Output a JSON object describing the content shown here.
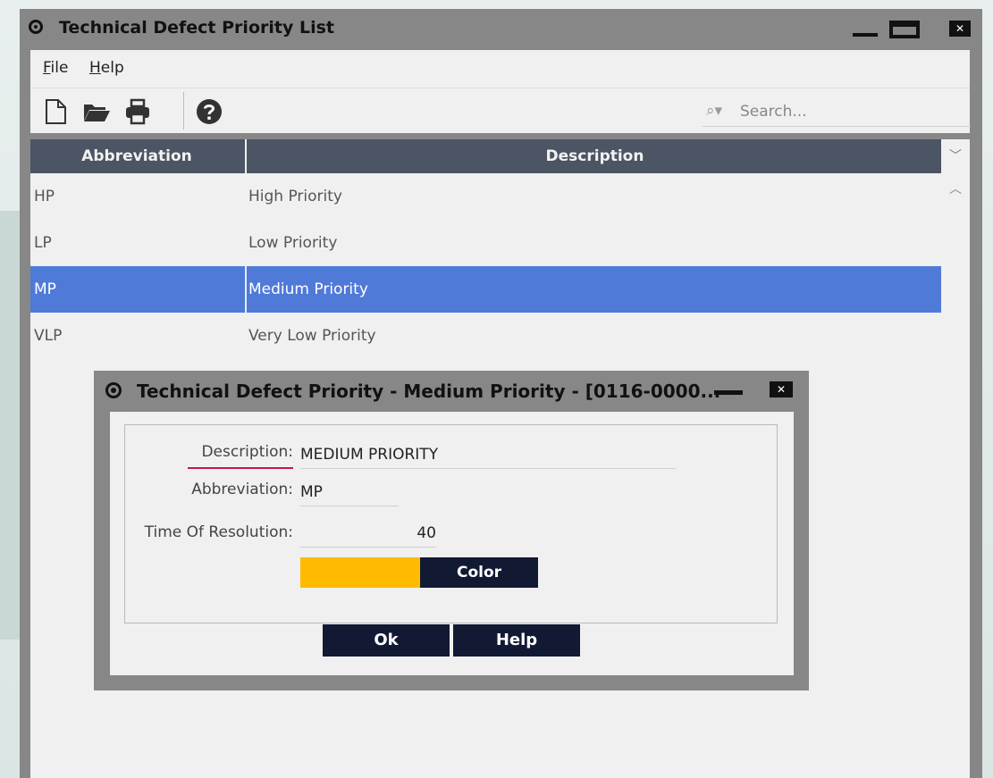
{
  "window": {
    "title": "Technical Defect Priority List",
    "controls": {
      "minimize": "minimize",
      "maximize": "maximize",
      "close": "✕"
    }
  },
  "menu": {
    "items": [
      {
        "label_first": "F",
        "label_rest": "ile"
      },
      {
        "label_first": "H",
        "label_rest": "elp"
      }
    ]
  },
  "toolbar": {
    "icons": [
      "new-document-icon",
      "open-folder-icon",
      "print-icon",
      "help-icon"
    ],
    "search_placeholder": "Search..."
  },
  "table": {
    "columns": [
      "Abbreviation",
      "Description"
    ],
    "rows": [
      {
        "abbr": "HP",
        "desc": "High Priority"
      },
      {
        "abbr": "LP",
        "desc": "Low Priority"
      },
      {
        "abbr": "MP",
        "desc": "Medium Priority",
        "selected": true
      },
      {
        "abbr": "VLP",
        "desc": "Very Low Priority"
      }
    ]
  },
  "dialog": {
    "title": "Technical Defect Priority - Medium Priority - [0116-0000...",
    "close": "✕",
    "fields": {
      "description_label": "Description:",
      "description_value": "MEDIUM PRIORITY",
      "abbreviation_label": "Abbreviation:",
      "abbreviation_value": "MP",
      "time_label": "Time Of Resolution:",
      "time_value": "40"
    },
    "color": {
      "swatch": "#ffbb00",
      "button_label": "Color"
    },
    "ok_label": "Ok",
    "help_label": "Help"
  },
  "colors": {
    "selection": "#4f7ad8",
    "header": "#4b5563",
    "button": "#121a33",
    "chrome": "#878787"
  }
}
